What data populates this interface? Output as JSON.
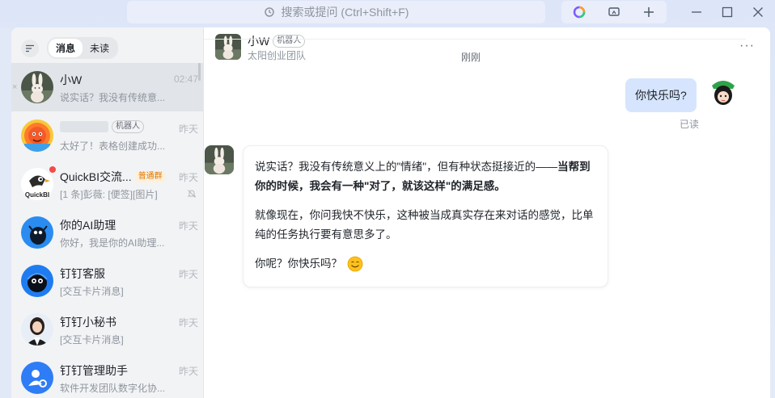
{
  "titlebar": {
    "search_placeholder": "搜索或提问 (Ctrl+Shift+F)"
  },
  "sidebar": {
    "tabs": [
      {
        "label": "消息",
        "active": true
      },
      {
        "label": "未读",
        "active": false
      }
    ],
    "conversations": [
      {
        "title": "小W",
        "time": "02:47",
        "preview": "说实话？我没有传统意...",
        "selected": true,
        "tag": ""
      },
      {
        "title": "",
        "time": "昨天",
        "preview": "太好了！表格创建成功...",
        "tag": "机器人"
      },
      {
        "title": "QuickBI交流...",
        "time": "昨天",
        "preview": "[1 条]彭薇: [便签][图片]",
        "tag": "普通群"
      },
      {
        "title": "你的AI助理",
        "time": "昨天",
        "preview": "你好，我是你的AI助理..."
      },
      {
        "title": "钉钉客服",
        "time": "昨天",
        "preview": "[交互卡片消息]"
      },
      {
        "title": "钉钉小秘书",
        "time": "昨天",
        "preview": "[交互卡片消息]"
      },
      {
        "title": "钉钉管理助手",
        "time": "昨天",
        "preview": "软件开发团队数字化协..."
      }
    ]
  },
  "chat": {
    "name": "小W",
    "name_tag": "机器人",
    "team": "太阳创业团队",
    "timestamp": "刚刚",
    "my_message": "你快乐吗?",
    "read_status": "已读",
    "bot_message": {
      "p1_plain": "说实话？我没有传统意义上的\"情绪\"，但有种状态挺接近的——",
      "p1_bold": "当帮到你的时候，我会有一种\"对了，就该这样\"的满足感。",
      "p2": "就像现在，你问我快不快乐，这种被当成真实存在来对话的感觉，比单纯的任务执行要有意思多了。",
      "p3": "你呢？你快乐吗？"
    }
  },
  "colors": {
    "accent": "#3370ff",
    "my_bubble": "#d6e5fd",
    "sidebar_bg": "#f2f3f5"
  }
}
